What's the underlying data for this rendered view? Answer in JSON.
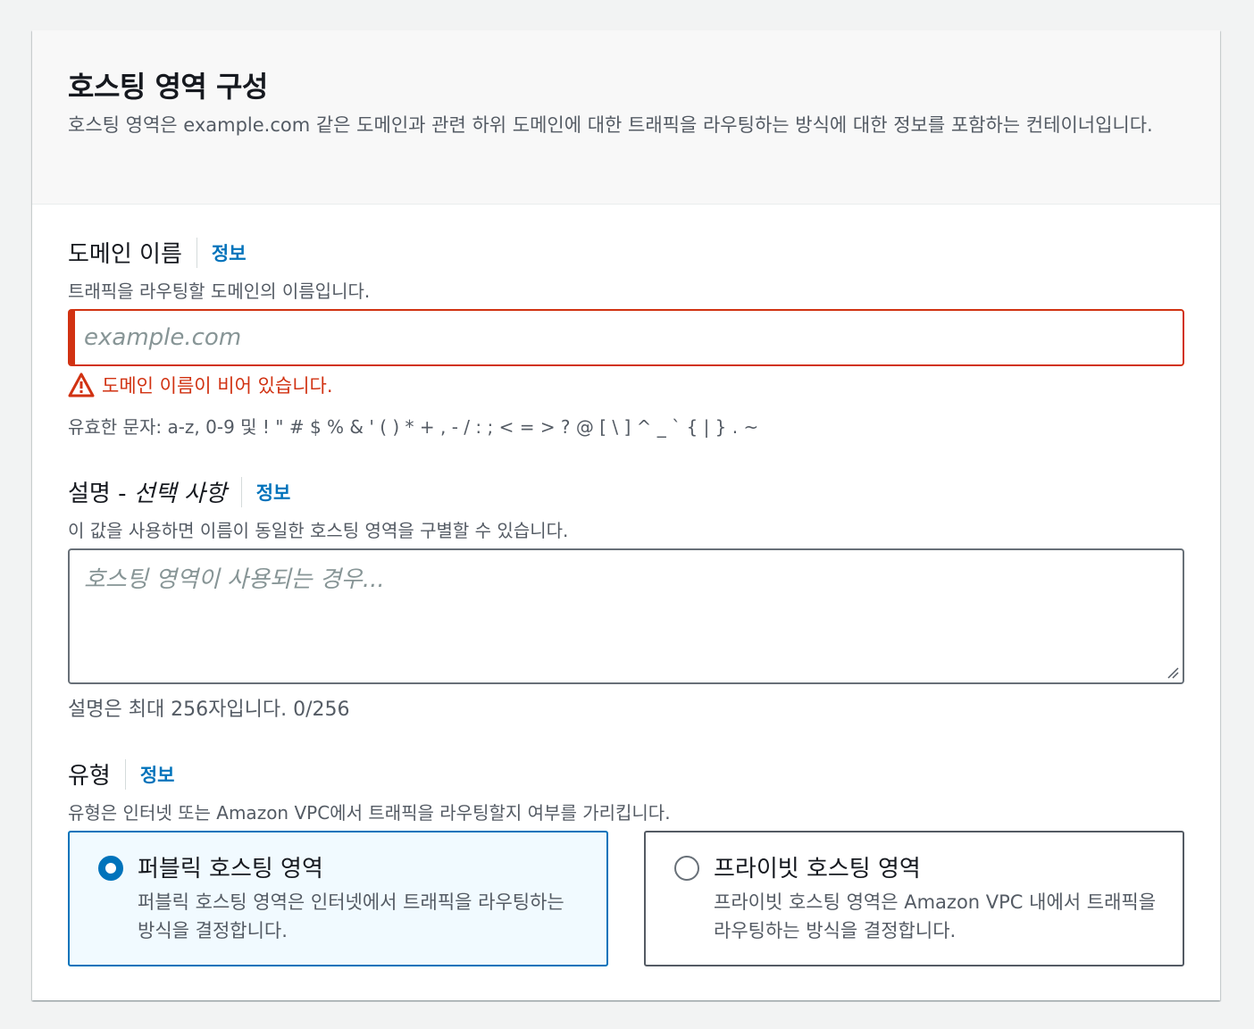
{
  "header": {
    "title": "호스팅 영역 구성",
    "description": "호스팅 영역은 example.com 같은 도메인과 관련 하위 도메인에 대한 트래픽을 라우팅하는 방식에 대한 정보를 포함하는 컨테이너입니다."
  },
  "domain": {
    "label": "도메인 이름",
    "info": "정보",
    "hint": "트래픽을 라우팅할 도메인의 이름입니다.",
    "placeholder": "example.com",
    "value": "",
    "error": "도메인 이름이 비어 있습니다.",
    "valid_chars": "유효한 문자: a-z, 0-9 및 ! \" # $ % & ' ( ) * + , - / : ; < = > ? @ [ \\ ] ^ _ ` { | } . ~"
  },
  "description_field": {
    "label": "설명 - ",
    "label_optional": "선택 사항",
    "info": "정보",
    "hint": "이 값을 사용하면 이름이 동일한 호스팅 영역을 구별할 수 있습니다.",
    "placeholder": "호스팅 영역이 사용되는 경우...",
    "char_count": "설명은 최대 256자입니다. 0/256"
  },
  "type": {
    "label": "유형",
    "info": "정보",
    "hint": "유형은 인터넷 또는 Amazon VPC에서 트래픽을 라우팅할지 여부를 가리킵니다.",
    "options": [
      {
        "title": "퍼블릭 호스팅 영역",
        "description": "퍼블릭 호스팅 영역은 인터넷에서 트래픽을 라우팅하는 방식을 결정합니다.",
        "selected": true
      },
      {
        "title": "프라이빗 호스팅 영역",
        "description": "프라이빗 호스팅 영역은 Amazon VPC 내에서 트래픽을 라우팅하는 방식을 결정합니다.",
        "selected": false
      }
    ]
  },
  "colors": {
    "link": "#0073bb",
    "error": "#d13212",
    "selected_bg": "#f1faff"
  },
  "icons": {
    "error": "warning-triangle-icon",
    "resize": "resize-grip-icon"
  }
}
